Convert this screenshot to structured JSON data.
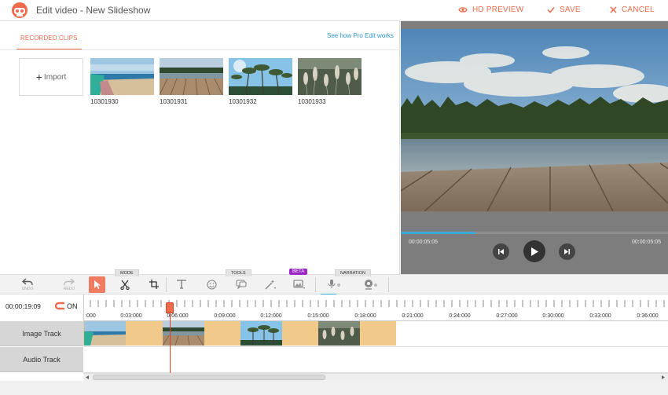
{
  "header": {
    "title": "Edit video - New Slideshow",
    "hd_preview": "HD PREVIEW",
    "save": "SAVE",
    "cancel": "CANCEL"
  },
  "clips_panel": {
    "tab": "RECORDED CLIPS",
    "pro_link": "See how Pro Edit works",
    "import_label": "Import",
    "clips": [
      {
        "name": "10301930",
        "scene": "beach"
      },
      {
        "name": "10301931",
        "scene": "pier"
      },
      {
        "name": "10301932",
        "scene": "palms"
      },
      {
        "name": "10301933",
        "scene": "grass"
      }
    ]
  },
  "preview": {
    "current_time": "00:00:05:05",
    "total_time": "00:00:05:05",
    "progress_fraction": 0.28
  },
  "toolbar": {
    "undo": "UNDO",
    "redo": "REDO",
    "mode_tab": "MODE",
    "tools_tab": "TOOLS",
    "narration_tab": "NARRATION",
    "beta": "BETA"
  },
  "timeline": {
    "timecode": "00:00:19:09",
    "snap_label": "ON",
    "ticks": [
      ":000",
      "0:03:000",
      "0:06:000",
      "0:09:000",
      "0:12:000",
      "0:15:000",
      "0:18:000",
      "0:21:000",
      "0:24:000",
      "0:27:000",
      "0:30:000",
      "0:33:000",
      "0:36:000"
    ],
    "tracks": [
      "Image Track",
      "Audio Track"
    ]
  },
  "colors": {
    "accent": "#ef6b4c",
    "link": "#2f95c5",
    "progress": "#3aa9d6",
    "clip_bar": "#f1c98a",
    "beta": "#9b29c6"
  }
}
